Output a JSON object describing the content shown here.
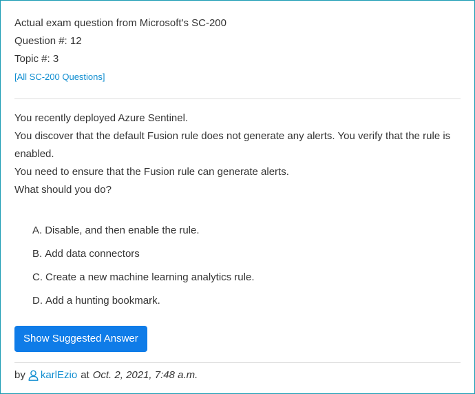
{
  "header": {
    "title": "Actual exam question from Microsoft's SC-200",
    "question_number": "Question #: 12",
    "topic_number": "Topic #: 3",
    "all_questions_link": "[All SC-200 Questions]"
  },
  "question": {
    "lines": [
      "You recently deployed Azure Sentinel.",
      "You discover that the default Fusion rule does not generate any alerts. You verify that the rule is enabled.",
      "You need to ensure that the Fusion rule can generate alerts.",
      "What should you do?"
    ]
  },
  "choices": [
    {
      "letter": "A.",
      "text": "Disable, and then enable the rule."
    },
    {
      "letter": "B.",
      "text": "Add data connectors"
    },
    {
      "letter": "C.",
      "text": "Create a new machine learning analytics rule."
    },
    {
      "letter": "D.",
      "text": "Add a hunting bookmark."
    }
  ],
  "actions": {
    "show_answer_label": "Show Suggested Answer"
  },
  "meta": {
    "by_label": "by",
    "username": "karlEzio",
    "at_label": "at",
    "date": "Oct. 2, 2021, 7:48 a.m."
  },
  "colors": {
    "accent": "#0f7ce8",
    "link": "#0f8dd0",
    "border": "#1a9bb3"
  },
  "icons": {
    "user": "user-outline-icon"
  }
}
